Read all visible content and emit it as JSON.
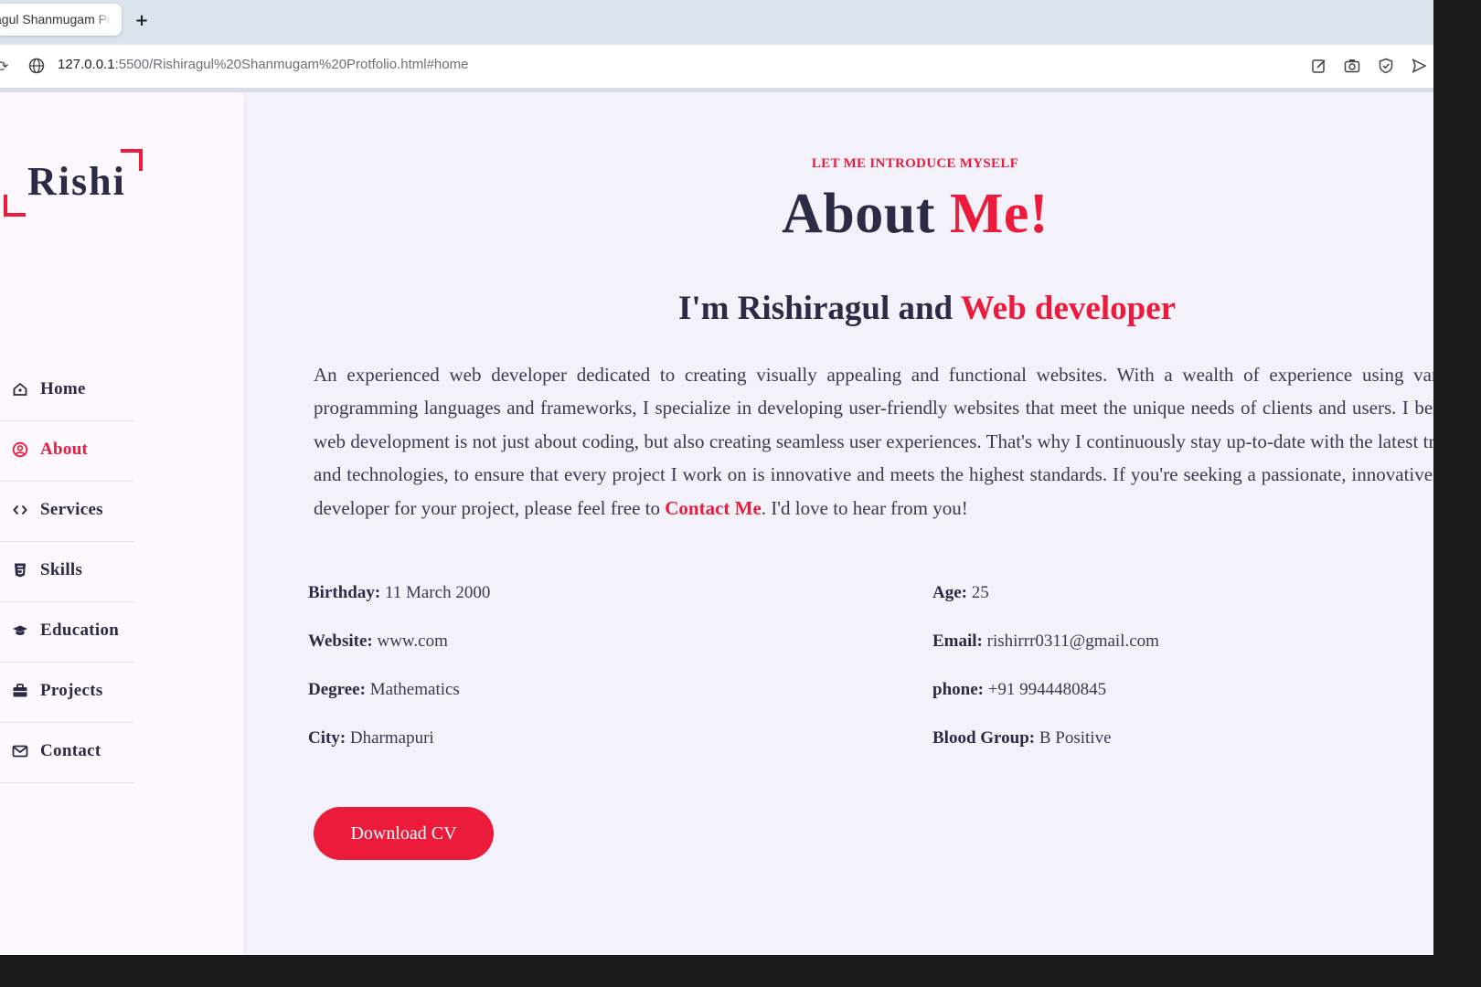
{
  "browser": {
    "tab_title": "Rishiragul Shanmugam Portfolio",
    "tab_title_visible": "agul Shanmugam Po",
    "new_tab_label": "+",
    "url_host": "127.0.0.1",
    "url_rest": ":5500/Rishiragul%20Shanmugam%20Protfolio.html#home",
    "icons": [
      "reload-icon",
      "site-info-icon",
      "edit-icon",
      "camera-icon",
      "shield-check-icon",
      "send-icon"
    ]
  },
  "sidebar": {
    "logo_text": "Rishi",
    "items": [
      {
        "label": "Home",
        "icon": "home-icon",
        "active": false
      },
      {
        "label": "About",
        "icon": "user-circle-icon",
        "active": true
      },
      {
        "label": "Services",
        "icon": "code-icon",
        "active": false
      },
      {
        "label": "Skills",
        "icon": "html5-icon",
        "active": false
      },
      {
        "label": "Education",
        "icon": "graduation-cap-icon",
        "active": false
      },
      {
        "label": "Projects",
        "icon": "briefcase-icon",
        "active": false
      },
      {
        "label": "Contact",
        "icon": "envelope-icon",
        "active": false
      }
    ]
  },
  "about": {
    "eyebrow": "LET ME INTRODUCE MYSELF",
    "title_plain": "About ",
    "title_accent": "Me!",
    "subtitle_plain": "I'm Rishiragul and ",
    "subtitle_accent": "Web developer",
    "bio_text": "An experienced web developer dedicated to creating visually appealing and functional websites. With a wealth of experience using various programming languages and frameworks, I specialize in developing user-friendly websites that meet the unique needs of clients and users. I believe web development is not just about coding, but also creating seamless user experiences. That's why I continuously stay up-to-date with the latest trends and technologies, to ensure that every project I work on is innovative and meets the highest standards. If you're seeking a passionate, innovative web developer for your project, please feel free to ",
    "contact_link": "Contact Me",
    "bio_end": ". I'd love to hear from you!",
    "info": {
      "birthday_label": "Birthday:",
      "birthday": "11 March 2000",
      "age_label": "Age:",
      "age": "25",
      "website_label": "Website:",
      "website": "www.com",
      "email_label": "Email:",
      "email": "rishirrr0311@gmail.com",
      "degree_label": "Degree:",
      "degree": "Mathematics",
      "phone_label": "phone:",
      "phone": "+91 9944480845",
      "city_label": "City:",
      "city": "Dharmapuri",
      "blood_label": "Blood Group:",
      "blood": "B Positive"
    },
    "cv_button": "Download CV"
  },
  "colors": {
    "accent": "#ec1b3b",
    "heading": "#2b2b45",
    "main_bg": "#f3f2fb",
    "sidebar_bg": "#fdf8fd"
  }
}
